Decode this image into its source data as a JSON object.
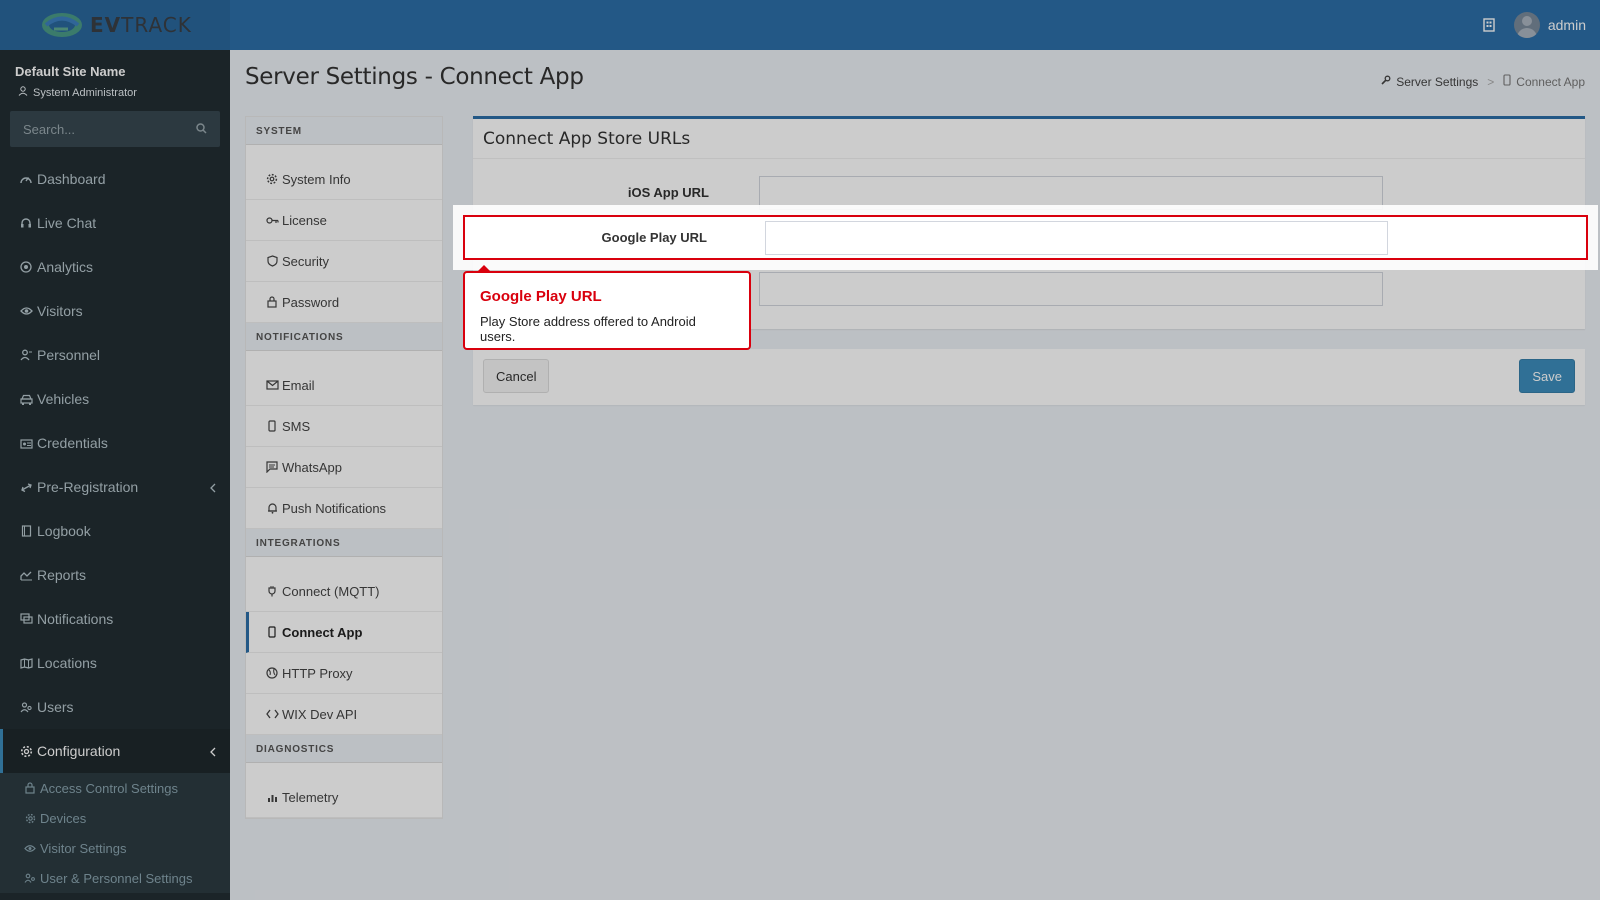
{
  "brand": {
    "name_bold": "EV",
    "name_rest": "TRACK"
  },
  "header": {
    "user": "admin"
  },
  "sidebar": {
    "site_name": "Default Site Name",
    "role": "System Administrator",
    "search_placeholder": "Search...",
    "items": [
      {
        "label": "Dashboard",
        "icon": "dashboard-icon"
      },
      {
        "label": "Live Chat",
        "icon": "headset-icon"
      },
      {
        "label": "Analytics",
        "icon": "target-icon"
      },
      {
        "label": "Visitors",
        "icon": "eye-icon"
      },
      {
        "label": "Personnel",
        "icon": "person-icon"
      },
      {
        "label": "Vehicles",
        "icon": "car-icon"
      },
      {
        "label": "Credentials",
        "icon": "id-card-icon"
      },
      {
        "label": "Pre-Registration",
        "icon": "arrows-icon"
      },
      {
        "label": "Logbook",
        "icon": "book-icon"
      },
      {
        "label": "Reports",
        "icon": "chart-icon"
      },
      {
        "label": "Notifications",
        "icon": "chat-icon"
      },
      {
        "label": "Locations",
        "icon": "map-icon"
      },
      {
        "label": "Users",
        "icon": "users-icon"
      },
      {
        "label": "Configuration",
        "icon": "gear-icon"
      }
    ],
    "submenu": [
      {
        "label": "Access Control Settings",
        "icon": "lock-icon"
      },
      {
        "label": "Devices",
        "icon": "gear-icon"
      },
      {
        "label": "Visitor Settings",
        "icon": "eye-icon"
      },
      {
        "label": "User & Personnel Settings",
        "icon": "users-icon"
      }
    ]
  },
  "page": {
    "title": "Server Settings - Connect App",
    "breadcrumb": {
      "root": "Server Settings",
      "current": "Connect App"
    }
  },
  "settings_nav": {
    "groups": [
      {
        "title": "SYSTEM",
        "items": [
          "System Info",
          "License",
          "Security",
          "Password"
        ]
      },
      {
        "title": "NOTIFICATIONS",
        "items": [
          "Email",
          "SMS",
          "WhatsApp",
          "Push Notifications"
        ]
      },
      {
        "title": "INTEGRATIONS",
        "items": [
          "Connect (MQTT)",
          "Connect App",
          "HTTP Proxy",
          "WIX Dev API"
        ]
      },
      {
        "title": "DIAGNOSTICS",
        "items": [
          "Telemetry"
        ]
      }
    ],
    "active": "Connect App"
  },
  "form": {
    "title": "Connect App Store URLs",
    "ios_label": "iOS App URL",
    "ios_value": "",
    "google_label": "Google Play URL",
    "google_value": "",
    "third_value": "",
    "cancel": "Cancel",
    "save": "Save"
  },
  "tooltip": {
    "title": "Google Play URL",
    "body": "Play Store address offered to Android users."
  }
}
